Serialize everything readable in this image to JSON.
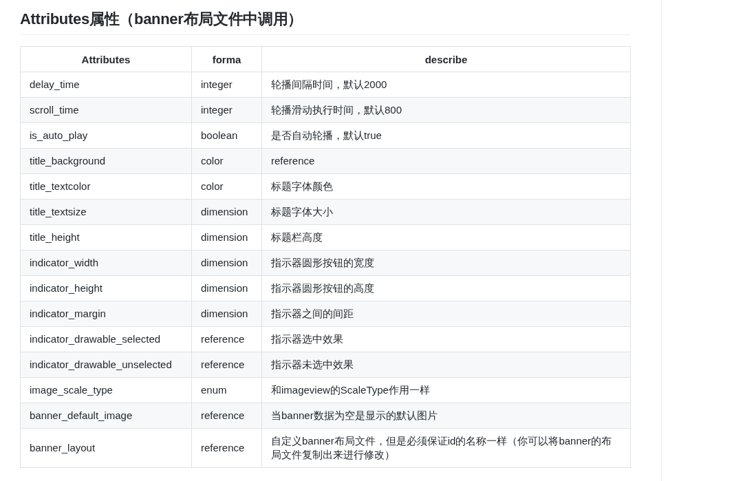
{
  "heading": "Attributes属性（banner布局文件中调用）",
  "table": {
    "columns": [
      "Attributes",
      "forma",
      "describe"
    ],
    "rows": [
      [
        "delay_time",
        "integer",
        "轮播间隔时间，默认2000"
      ],
      [
        "scroll_time",
        "integer",
        "轮播滑动执行时间，默认800"
      ],
      [
        "is_auto_play",
        "boolean",
        "是否自动轮播，默认true"
      ],
      [
        "title_background",
        "color",
        "reference"
      ],
      [
        "title_textcolor",
        "color",
        "标题字体颜色"
      ],
      [
        "title_textsize",
        "dimension",
        "标题字体大小"
      ],
      [
        "title_height",
        "dimension",
        "标题栏高度"
      ],
      [
        "indicator_width",
        "dimension",
        "指示器圆形按钮的宽度"
      ],
      [
        "indicator_height",
        "dimension",
        "指示器圆形按钮的高度"
      ],
      [
        "indicator_margin",
        "dimension",
        "指示器之间的间距"
      ],
      [
        "indicator_drawable_selected",
        "reference",
        "指示器选中效果"
      ],
      [
        "indicator_drawable_unselected",
        "reference",
        "指示器未选中效果"
      ],
      [
        "image_scale_type",
        "enum",
        "和imageview的ScaleType作用一样"
      ],
      [
        "banner_default_image",
        "reference",
        "当banner数据为空是显示的默认图片"
      ],
      [
        "banner_layout",
        "reference",
        "自定义banner布局文件，但是必须保证id的名称一样（你可以将banner的布局文件复制出来进行修改）"
      ]
    ]
  }
}
